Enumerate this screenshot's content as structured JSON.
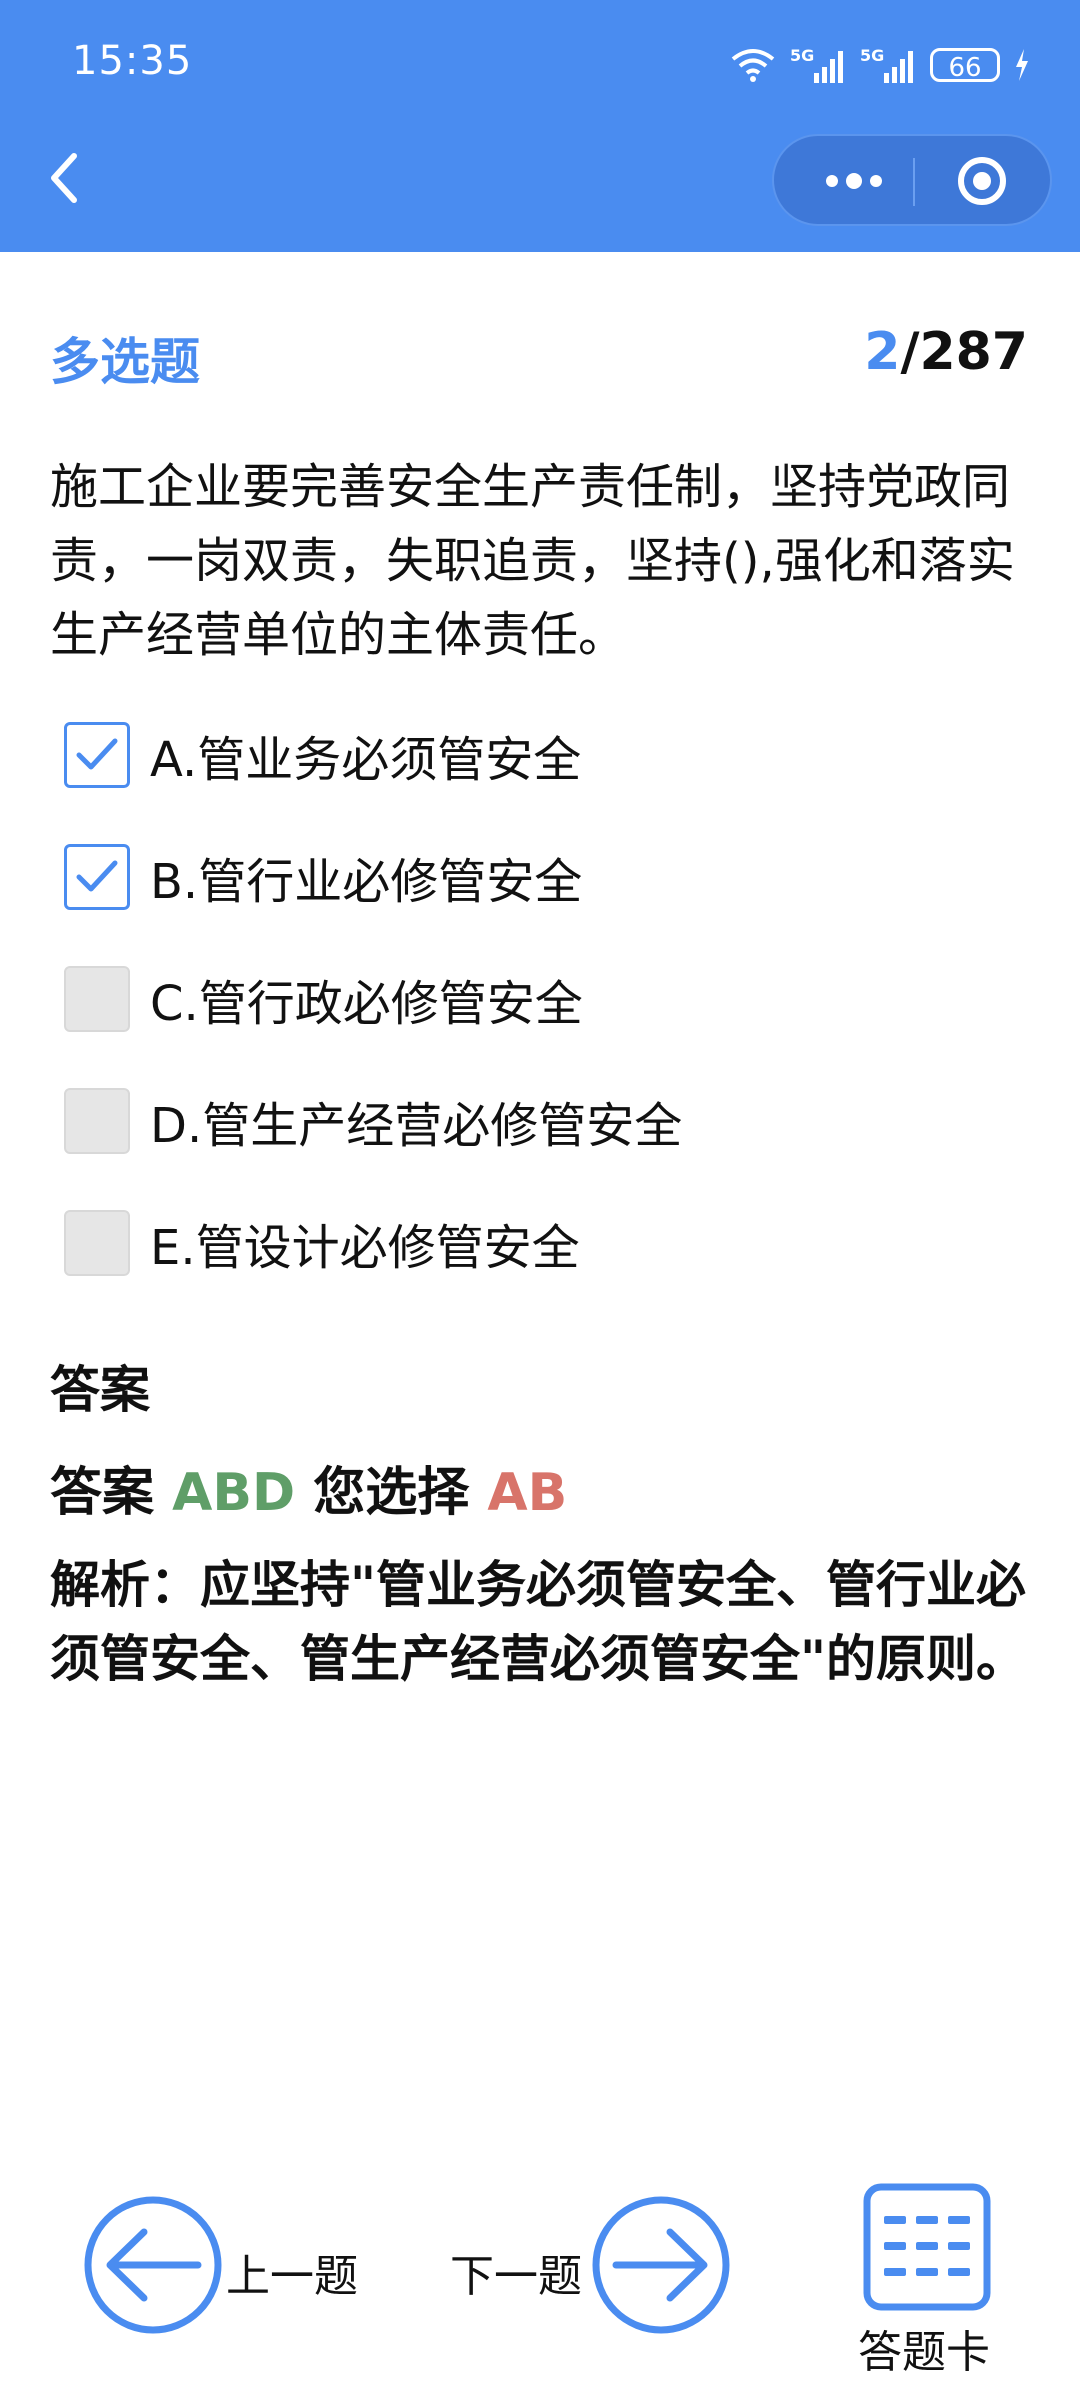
{
  "status": {
    "time": "15:35",
    "battery": "66"
  },
  "header": {
    "back_icon": "chevron-left-icon",
    "more_icon": "more-dots-icon",
    "close_icon": "target-icon"
  },
  "question": {
    "type": "多选题",
    "current": "2",
    "total": "/287",
    "text": "施工企业要完善安全生产责任制，坚持党政同责，一岗双责，失职追责，坚持(),强化和落实生产经营单位的主体责任。",
    "options": [
      {
        "label": "A.管业务必须管安全",
        "checked": true
      },
      {
        "label": "B.管行业必修管安全",
        "checked": true
      },
      {
        "label": "C.管行政必修管安全",
        "checked": false
      },
      {
        "label": "D.管生产经营必修管安全",
        "checked": false
      },
      {
        "label": "E.管设计必修管安全",
        "checked": false
      }
    ]
  },
  "answer": {
    "title": "答案",
    "prefix": "答案",
    "correct": "ABD",
    "chose_label": "您选择",
    "chosen": "AB",
    "analysis": "解析：应坚持\"管业务必须管安全、管行业必须管安全、管生产经营必须管安全\"的原则。"
  },
  "footer": {
    "prev_label": "上一题",
    "next_label": "下一题",
    "card_label": "答题卡"
  },
  "colors": {
    "accent": "#4a8cf0",
    "correct": "#5f9e68",
    "wrong": "#d8746a"
  }
}
